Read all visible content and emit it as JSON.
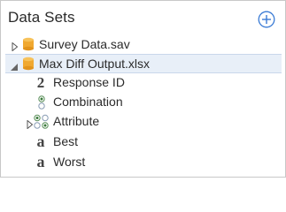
{
  "panel": {
    "title": "Data Sets"
  },
  "data_sets": [
    {
      "name": "Survey Data.sav",
      "expanded": false,
      "selected": false
    },
    {
      "name": "Max Diff Output.xlsx",
      "expanded": true,
      "selected": true,
      "variables": [
        {
          "label": "Response ID",
          "type_glyph": "2",
          "icon": "numeric-variable-icon"
        },
        {
          "label": "Combination",
          "icon": "single-response-variable-icon"
        },
        {
          "label": "Attribute",
          "icon": "multi-response-variable-icon",
          "expandable": true
        },
        {
          "label": "Best",
          "type_glyph": "a",
          "icon": "text-variable-icon"
        },
        {
          "label": "Worst",
          "type_glyph": "a",
          "icon": "text-variable-icon"
        }
      ]
    }
  ],
  "colors": {
    "accent": "#3a7bd5",
    "database": "#f0a830",
    "selection": "#e8eff8"
  }
}
